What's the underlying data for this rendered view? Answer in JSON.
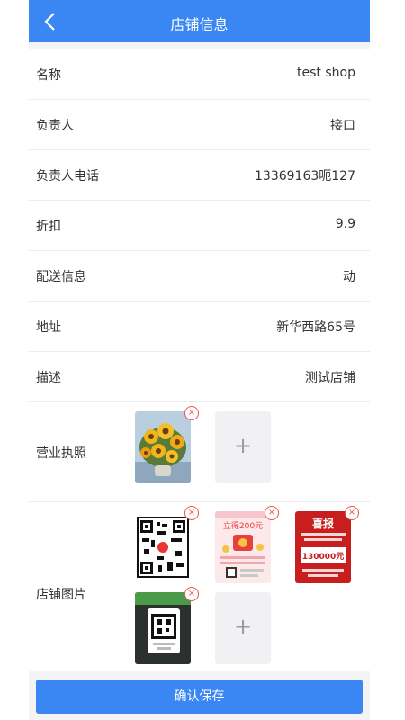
{
  "header": {
    "title": "店铺信息"
  },
  "fields": [
    {
      "label": "名称",
      "value": "test  shop"
    },
    {
      "label": "负责人",
      "value": "接口"
    },
    {
      "label": "负责人电话",
      "value": "13369163呃127"
    },
    {
      "label": "折扣",
      "value": "9.9"
    },
    {
      "label": "配送信息",
      "value": "动"
    },
    {
      "label": "地址",
      "value": "新华西路65号"
    },
    {
      "label": "描述",
      "value": "测试店铺"
    }
  ],
  "license": {
    "label": "营业执照"
  },
  "shop_images": {
    "label": "店铺图片",
    "img2": {
      "big": "立得200元"
    },
    "img3": {
      "title": "喜报",
      "amount": "130000元"
    }
  },
  "add_symbol": "+",
  "delete_symbol": "×",
  "footer": {
    "save_label": "确认保存"
  }
}
